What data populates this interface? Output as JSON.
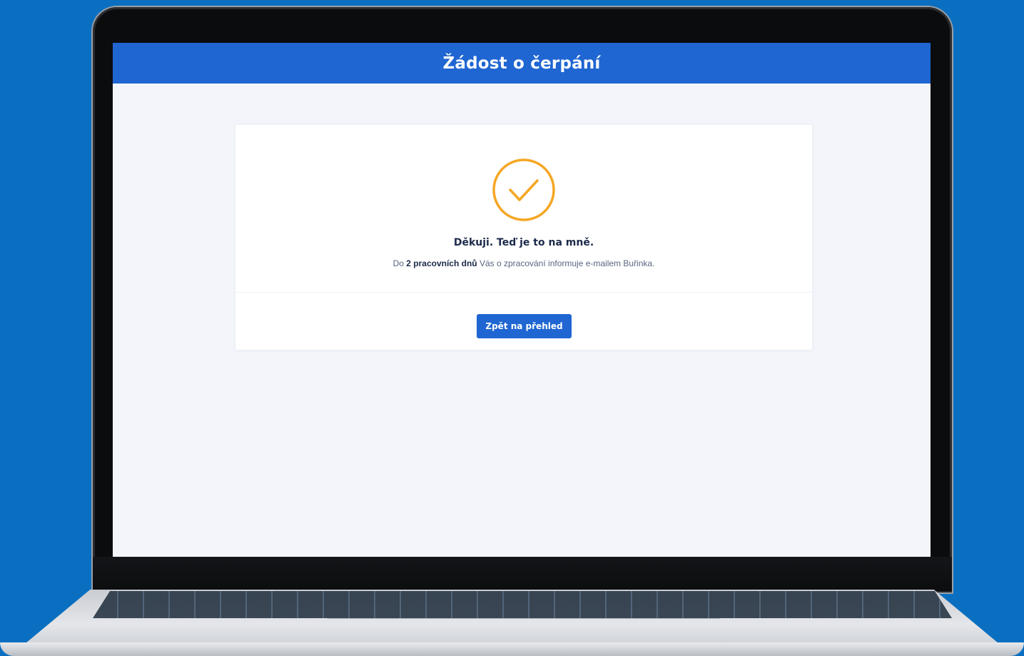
{
  "header": {
    "title": "Žádost o čerpání"
  },
  "confirmation": {
    "icon": "check-circle-icon",
    "heading": "Děkuji. Teď je to na mně.",
    "info_prefix": "Do",
    "info_bold": "2 pracovních dnů",
    "info_suffix": "Vás o zpracování informuje e-mailem Buřinka."
  },
  "actions": {
    "back_label": "Zpět na přehled"
  },
  "colors": {
    "background": "#0a6fc0",
    "header": "#1f66d2",
    "accent_check": "#f5a623",
    "button": "#1f66d2"
  }
}
